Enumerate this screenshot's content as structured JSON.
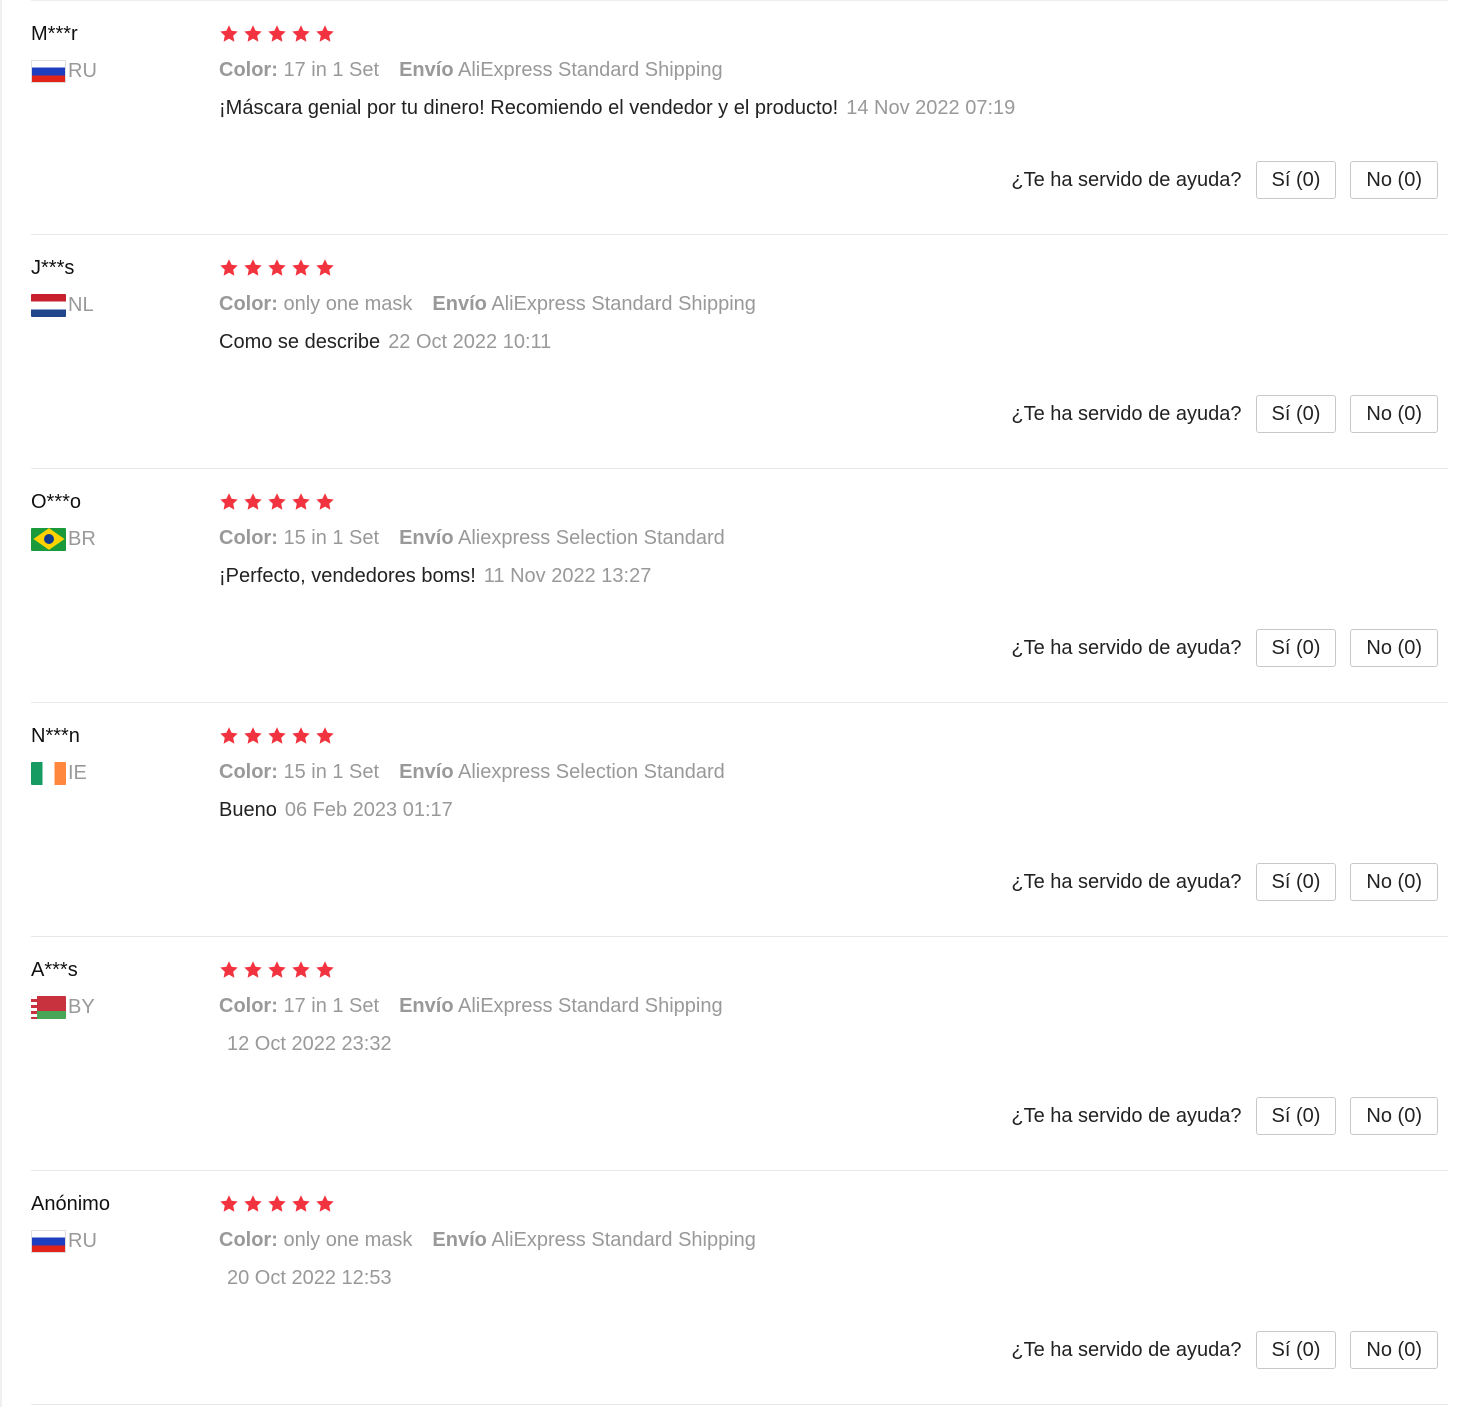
{
  "star_color": "#f0333e",
  "reviews": [
    {
      "user": "M***r",
      "country": "RU",
      "flag_icon": "russia-flag-icon",
      "rating": 5,
      "color_label": "Color:",
      "color_value": "17 in 1 Set",
      "shipping_label": "Envío",
      "shipping_value": "AliExpress Standard Shipping",
      "text": "¡Máscara genial por tu dinero! Recomiendo el vendedor y el producto!",
      "date": "14 Nov 2022 07:19",
      "helpful_label": "¿Te ha servido de ayuda?",
      "yes_label": "Sí (0)",
      "no_label": "No (0)"
    },
    {
      "user": "J***s",
      "country": "NL",
      "flag_icon": "netherlands-flag-icon",
      "rating": 5,
      "color_label": "Color:",
      "color_value": "only one mask",
      "shipping_label": "Envío",
      "shipping_value": "AliExpress Standard Shipping",
      "text": "Como se describe",
      "date": "22 Oct 2022 10:11",
      "helpful_label": "¿Te ha servido de ayuda?",
      "yes_label": "Sí (0)",
      "no_label": "No (0)"
    },
    {
      "user": "O***o",
      "country": "BR",
      "flag_icon": "brazil-flag-icon",
      "rating": 5,
      "color_label": "Color:",
      "color_value": "15 in 1 Set",
      "shipping_label": "Envío",
      "shipping_value": "Aliexpress Selection Standard",
      "text": "¡Perfecto, vendedores boms!",
      "date": "11 Nov 2022 13:27",
      "helpful_label": "¿Te ha servido de ayuda?",
      "yes_label": "Sí (0)",
      "no_label": "No (0)"
    },
    {
      "user": "N***n",
      "country": "IE",
      "flag_icon": "ireland-flag-icon",
      "rating": 5,
      "color_label": "Color:",
      "color_value": "15 in 1 Set",
      "shipping_label": "Envío",
      "shipping_value": "Aliexpress Selection Standard",
      "text": "Bueno",
      "date": "06 Feb 2023 01:17",
      "helpful_label": "¿Te ha servido de ayuda?",
      "yes_label": "Sí (0)",
      "no_label": "No (0)"
    },
    {
      "user": "A***s",
      "country": "BY",
      "flag_icon": "belarus-flag-icon",
      "rating": 5,
      "color_label": "Color:",
      "color_value": "17 in 1 Set",
      "shipping_label": "Envío",
      "shipping_value": "AliExpress Standard Shipping",
      "text": "",
      "date": "12 Oct 2022 23:32",
      "helpful_label": "¿Te ha servido de ayuda?",
      "yes_label": "Sí (0)",
      "no_label": "No (0)"
    },
    {
      "user": "Anónimo",
      "country": "RU",
      "flag_icon": "russia-flag-icon",
      "rating": 5,
      "color_label": "Color:",
      "color_value": "only one mask",
      "shipping_label": "Envío",
      "shipping_value": "AliExpress Standard Shipping",
      "text": "",
      "date": "20 Oct 2022 12:53",
      "helpful_label": "¿Te ha servido de ayuda?",
      "yes_label": "Sí (0)",
      "no_label": "No (0)"
    }
  ]
}
